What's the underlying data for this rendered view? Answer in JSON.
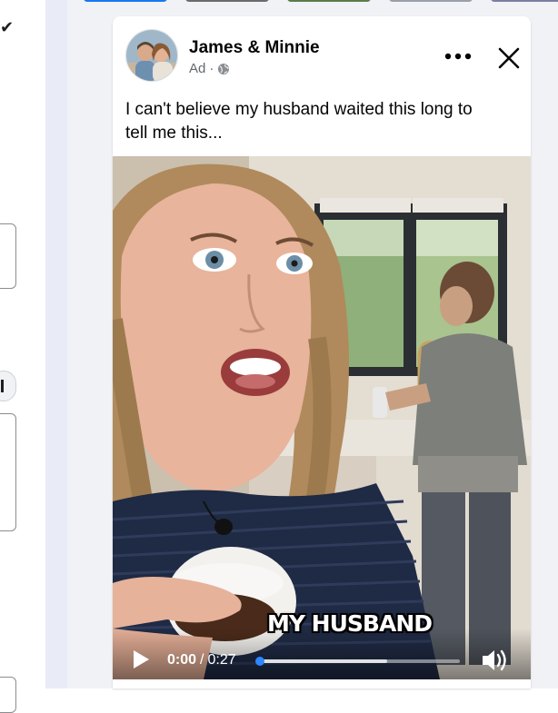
{
  "post": {
    "page_name": "James & Minnie",
    "sponsored_label": "Ad",
    "separator": "·",
    "privacy_icon": "globe-icon",
    "more_icon": "more-options-icon",
    "close_icon": "close-icon",
    "caption_line1": "I can't believe my husband waited this long to",
    "caption_line2": "tell me this..."
  },
  "video": {
    "subtitle": "MY HUSBAND",
    "current_time": "0:00",
    "time_separator": "/",
    "duration": "0:27",
    "progress_fraction": 0.0,
    "buffered_fraction": 0.64,
    "play_icon": "play-icon",
    "volume_icon": "volume-icon"
  },
  "colors": {
    "accent": "#2d88ff",
    "feed_background": "#f0f2f5",
    "secondary_text": "#65676b"
  }
}
